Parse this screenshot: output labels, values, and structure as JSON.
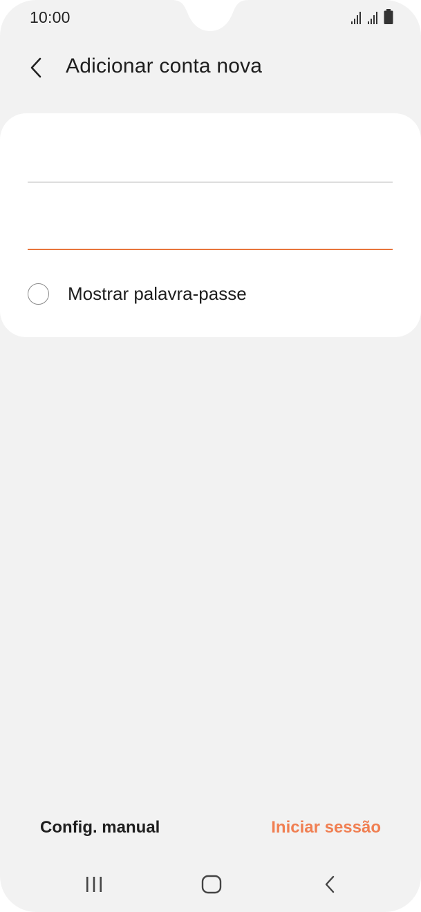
{
  "status_bar": {
    "time": "10:00",
    "icons": [
      "signal-icon",
      "signal-icon",
      "battery-icon"
    ]
  },
  "header": {
    "back_icon": "chevron-left-icon",
    "title": "Adicionar conta nova"
  },
  "form": {
    "email_value": "",
    "password_value": "",
    "show_password_label": "Mostrar palavra-passe",
    "show_password_checked": false,
    "active_field_color": "#e8743b"
  },
  "actions": {
    "manual_label": "Config. manual",
    "signin_label": "Iniciar sessão",
    "accent_color": "#f07f52"
  },
  "navbar": {
    "recents_icon": "recents-icon",
    "home_icon": "home-icon",
    "back_icon": "back-icon"
  }
}
